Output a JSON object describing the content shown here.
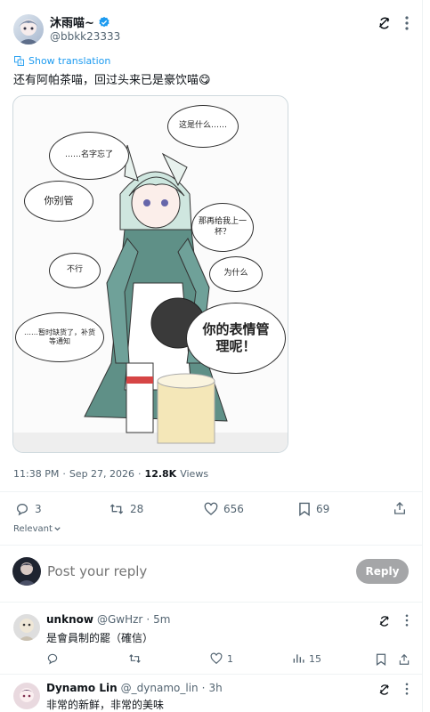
{
  "post": {
    "author_name": "沐雨喵~",
    "handle": "@bbkk23333",
    "show_translation": "Show translation",
    "text": "还有阿帕茶喵，回过头来已是豪饮喵",
    "emoji": "😋",
    "image": {
      "bubbles": [
        "这是什么……",
        "……名字忘了",
        "你别管",
        "那再给我上一杯？",
        "不行",
        "为什么",
        "……暂时缺货了，补货等通知",
        "你的表情管理呢！"
      ]
    },
    "time": "11:38 PM",
    "date": "Sep 27, 2026",
    "views_count": "12.8K",
    "views_label": "Views",
    "stats": {
      "replies": "3",
      "reposts": "28",
      "likes": "656",
      "bookmarks": "69"
    }
  },
  "sort": {
    "label": "Relevant"
  },
  "compose": {
    "placeholder": "Post your reply",
    "button": "Reply"
  },
  "replies": [
    {
      "name": "unknow",
      "handle": "@GwHzr",
      "time": "5m",
      "text": "是會員制的罷（確信）",
      "likes": "1",
      "views": "15"
    },
    {
      "name": "Dynamo Lin",
      "handle": "@_dynamo_lin",
      "time": "3h",
      "text": "非常的新鲜，非常的美味"
    }
  ],
  "colors": {
    "accent": "#1d9bf0",
    "verified": "#1d9bf0",
    "muted": "#536471",
    "divider": "#eff3f4"
  }
}
